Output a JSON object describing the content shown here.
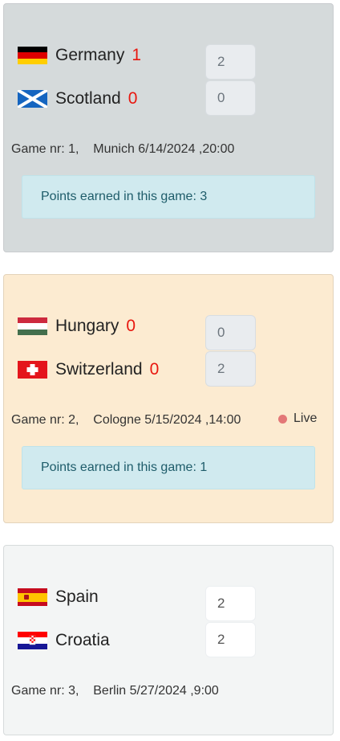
{
  "games": [
    {
      "home": {
        "name": "Germany",
        "score": "1",
        "flag": "germany-flag"
      },
      "away": {
        "name": "Scotland",
        "score": "0",
        "flag": "scotland-flag"
      },
      "prediction": {
        "home": "2",
        "away": "0"
      },
      "info": "Game nr: 1,    Munich 6/14/2024 ,20:00",
      "points_text": "Points earned in this game: 3",
      "status": ""
    },
    {
      "home": {
        "name": "Hungary",
        "score": "0",
        "flag": "hungary-flag"
      },
      "away": {
        "name": "Switzerland",
        "score": "0",
        "flag": "switzerland-flag"
      },
      "prediction": {
        "home": "0",
        "away": "2"
      },
      "info": "Game nr: 2,    Cologne 5/15/2024 ,14:00",
      "points_text": "Points earned in this game: 1",
      "status": "Live"
    },
    {
      "home": {
        "name": "Spain",
        "score": "",
        "flag": "spain-flag"
      },
      "away": {
        "name": "Croatia",
        "score": "",
        "flag": "croatia-flag"
      },
      "prediction": {
        "home": "2",
        "away": "2"
      },
      "info": "Game nr: 3,    Berlin 5/27/2024 ,9:00",
      "points_text": "",
      "status": ""
    }
  ],
  "colors": {
    "finished_card": "#d5dadb",
    "live_card": "#fcebd1",
    "upcoming_card": "#f3f5f5",
    "score": "#e8170f",
    "live_dot": "#e37777",
    "points_bg": "#d0eaef"
  }
}
